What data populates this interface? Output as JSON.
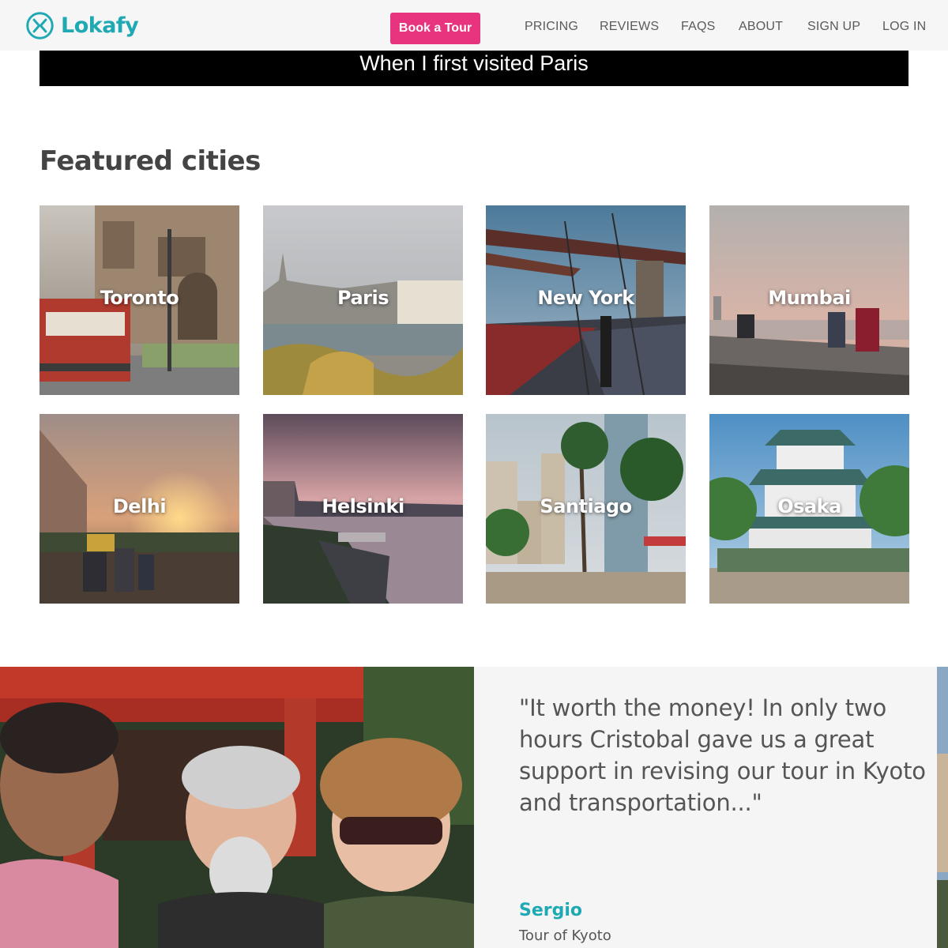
{
  "header": {
    "logo_text": "Lokafy",
    "book_button": "Book a Tour",
    "nav": [
      "PRICING",
      "REVIEWS",
      "FAQS",
      "ABOUT",
      "SIGN UP",
      "LOG IN"
    ]
  },
  "video": {
    "caption": "When I first visited Paris"
  },
  "featured": {
    "title": "Featured cities",
    "cities": [
      "Toronto",
      "Paris",
      "New York",
      "Mumbai",
      "Delhi",
      "Helsinki",
      "Santiago",
      "Osaka"
    ]
  },
  "testimonial": {
    "quote": "\"It worth the money! In only two hours Cristobal gave us a great support in revising our tour in Kyoto and transportation...\"",
    "author": "Sergio",
    "tour": "Tour of Kyoto"
  },
  "colors": {
    "brand_teal": "#1fa9b3",
    "accent_pink": "#e8347f",
    "header_bg": "#f6f6f6",
    "panel_bg": "#f5f5f5"
  }
}
